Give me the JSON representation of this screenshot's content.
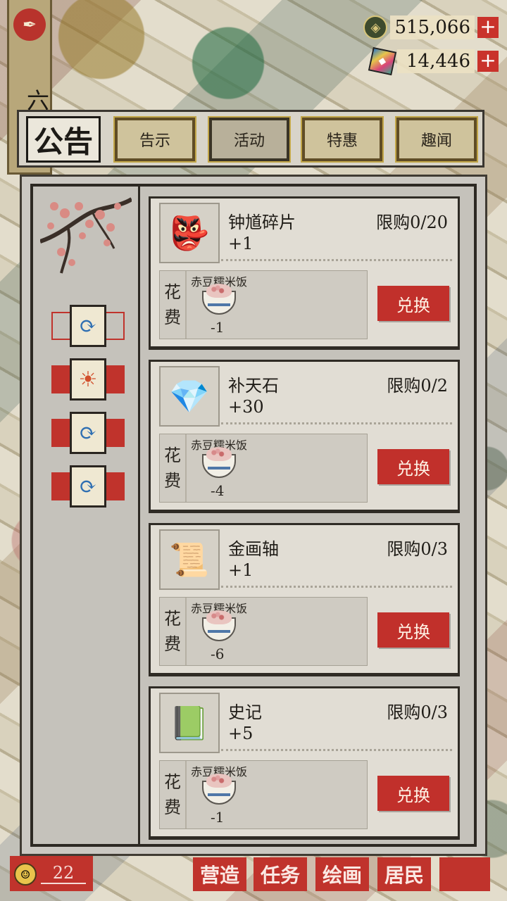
{
  "banner": {
    "icon": "brush-seal-icon",
    "text": "六十"
  },
  "currencies": [
    {
      "icon": "coin-icon",
      "value": "515,066",
      "plus": "+"
    },
    {
      "icon": "gem-icon",
      "value": "14,446",
      "plus": "+"
    }
  ],
  "header": {
    "title": "公告",
    "tabs": [
      {
        "label": "告示",
        "active": false
      },
      {
        "label": "活动",
        "active": true
      },
      {
        "label": "特惠",
        "active": false
      },
      {
        "label": "趣闻",
        "active": false
      }
    ]
  },
  "sidebar": {
    "buttons": [
      {
        "icon": "exchange-arrows-icon",
        "selected": true
      },
      {
        "icon": "sun-swirl-icon",
        "selected": false
      },
      {
        "icon": "exchange-arrows-icon",
        "selected": false
      },
      {
        "icon": "exchange-arrows-icon",
        "selected": false
      }
    ]
  },
  "items": [
    {
      "name": "钟馗碎片",
      "amount": "+1",
      "limit": "限购0/20",
      "icon": "zhong-kui-portrait-icon",
      "cost_label_1": "花",
      "cost_label_2": "费",
      "cost_food": "赤豆糯米饭",
      "cost_qty": "-1",
      "button": "兑换"
    },
    {
      "name": "补天石",
      "amount": "+30",
      "limit": "限购0/2",
      "icon": "rainbow-stone-icon",
      "cost_label_1": "花",
      "cost_label_2": "费",
      "cost_food": "赤豆糯米饭",
      "cost_qty": "-4",
      "button": "兑换"
    },
    {
      "name": "金画轴",
      "amount": "+1",
      "limit": "限购0/3",
      "icon": "golden-scroll-icon",
      "cost_label_1": "花",
      "cost_label_2": "费",
      "cost_food": "赤豆糯米饭",
      "cost_qty": "-6",
      "button": "兑换"
    },
    {
      "name": "史记",
      "amount": "+5",
      "limit": "限购0/3",
      "icon": "green-book-icon",
      "cost_label_1": "花",
      "cost_label_2": "费",
      "cost_food": "赤豆糯米饭",
      "cost_qty": "-1",
      "button": "兑换"
    }
  ],
  "bottom": {
    "level": "22",
    "nav": [
      "营造",
      "任务",
      "绘画",
      "居民",
      ""
    ]
  }
}
